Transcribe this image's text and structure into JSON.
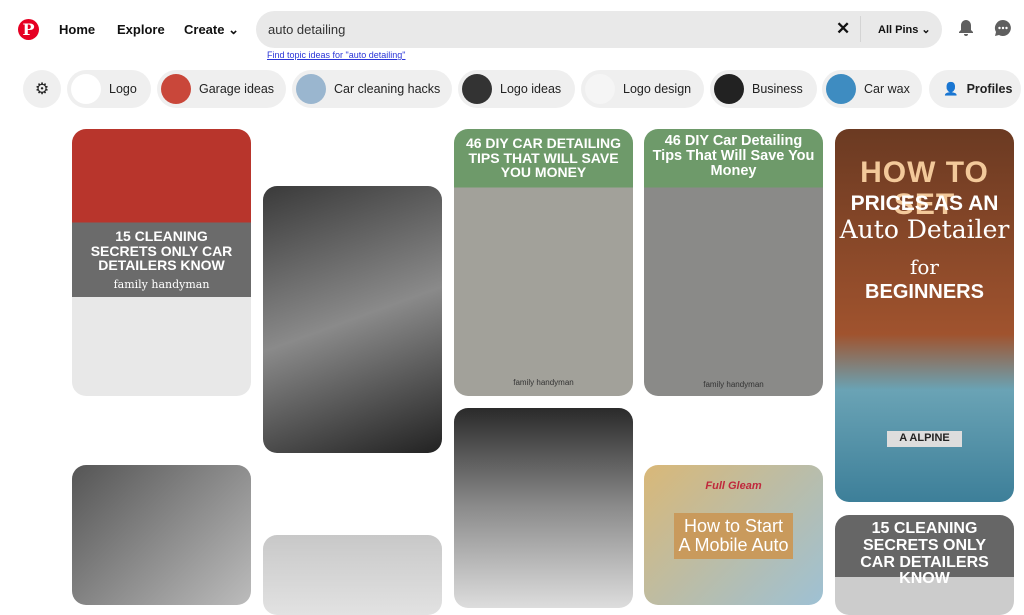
{
  "header": {
    "logo": "P",
    "nav": [
      "Home",
      "Explore",
      "Create"
    ],
    "search_value": "auto detailing",
    "search_filter": "All Pins",
    "topic_link": "Find topic ideas for \"auto detailing\""
  },
  "chips": [
    {
      "label": "Logo"
    },
    {
      "label": "Garage ideas"
    },
    {
      "label": "Car cleaning hacks"
    },
    {
      "label": "Logo ideas"
    },
    {
      "label": "Logo design"
    },
    {
      "label": "Business"
    },
    {
      "label": "Car wax"
    },
    {
      "label": "Profiles"
    }
  ],
  "pins": {
    "p1": {
      "title": "15 CLEANING SECRETS ONLY CAR DETAILERS KNOW",
      "brand": "family handyman"
    },
    "p3": {
      "title": "46 DIY CAR DETAILING TIPS THAT WILL SAVE YOU MONEY",
      "brand": "family handyman"
    },
    "p4": {
      "title": "46 DIY Car Detailing Tips That Will Save You Money",
      "brand": "family handyman"
    },
    "p5": {
      "line1": "HOW TO SET",
      "line2": "PRICES AS AN",
      "line3": "Auto Detailer",
      "line4": "for",
      "line5": "BEGINNERS",
      "plate": "A ALPINE"
    },
    "p9": {
      "brand": "Full Gleam",
      "title": "How to Start A Mobile Auto"
    },
    "p10": {
      "title": "15 CLEANING SECRETS ONLY CAR DETAILERS KNOW"
    }
  },
  "colors": {
    "brand": "#e60023",
    "chip_bg": "#efefef"
  }
}
